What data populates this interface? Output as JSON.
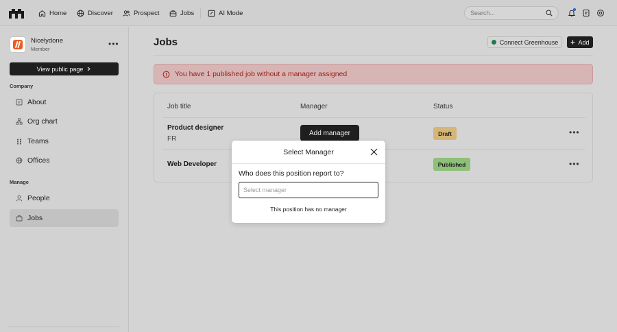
{
  "nav": {
    "items": [
      {
        "label": "Home",
        "icon": "home-icon"
      },
      {
        "label": "Discover",
        "icon": "globe-icon"
      },
      {
        "label": "Prospect",
        "icon": "users-icon"
      },
      {
        "label": "Jobs",
        "icon": "briefcase-icon"
      },
      {
        "label": "AI Mode",
        "icon": "ai-mode-icon"
      }
    ],
    "search_placeholder": "Search..."
  },
  "sidebar": {
    "org_name": "Nicelydone",
    "org_role": "Member",
    "view_public_label": "View public page",
    "company_label": "Company",
    "company_items": [
      {
        "label": "About",
        "icon": "about-icon"
      },
      {
        "label": "Org chart",
        "icon": "org-chart-icon"
      },
      {
        "label": "Teams",
        "icon": "teams-icon"
      },
      {
        "label": "Offices",
        "icon": "globe-icon"
      }
    ],
    "manage_label": "Manage",
    "manage_items": [
      {
        "label": "People",
        "icon": "person-icon"
      },
      {
        "label": "Jobs",
        "icon": "briefcase-icon",
        "active": true
      }
    ]
  },
  "main": {
    "title": "Jobs",
    "connect_label": "Connect Greenhouse",
    "add_label": "Add",
    "alert_text": "You have 1 published job without a manager assigned",
    "columns": [
      "Job title",
      "Manager",
      "Status"
    ],
    "rows": [
      {
        "title": "Product designer",
        "subtitle": "FR",
        "manager_button": "Add manager",
        "status": "Draft"
      },
      {
        "title": "Web Developer",
        "status": "Published"
      }
    ]
  },
  "modal": {
    "title": "Select Manager",
    "question": "Who does this position report to?",
    "input_placeholder": "Select manager",
    "input_value": "",
    "no_manager_label": "This position has no manager"
  },
  "colors": {
    "alert_bg": "#d7b5b5",
    "alert_text": "#9b1c1c",
    "draft": "#d6b676",
    "published": "#8fc07a",
    "dark_button": "#1f1f1f"
  }
}
